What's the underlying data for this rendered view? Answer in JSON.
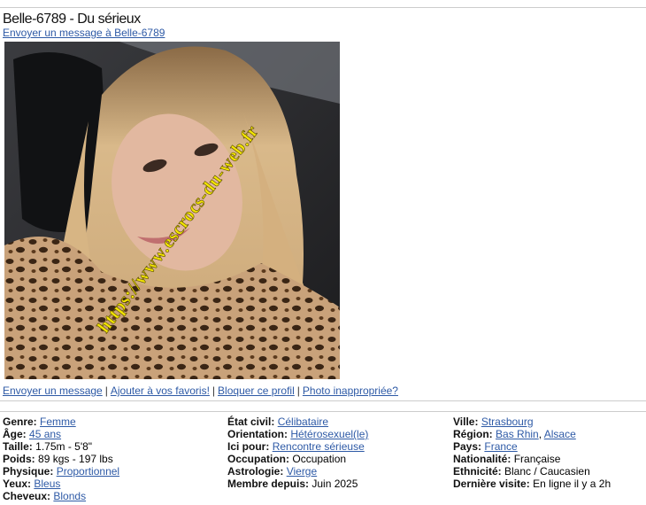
{
  "profile": {
    "title": "Belle-6789 - Du sérieux",
    "message_link": "Envoyer un message à Belle-6789",
    "watermark": "https://www.escrocs-du-web.fr"
  },
  "actions": {
    "send_message": "Envoyer un message",
    "add_favorite": "Ajouter à vos favoris!",
    "block": "Bloquer ce profil",
    "report_photo": "Photo inappropriée?",
    "separator": "|"
  },
  "details": {
    "col1": [
      {
        "label": "Genre:",
        "value": "Femme",
        "link": true
      },
      {
        "label": "Âge:",
        "value": "45 ans",
        "link": true
      },
      {
        "label": "Taille:",
        "value": "1.75m - 5'8\"",
        "link": false
      },
      {
        "label": "Poids:",
        "value": "89 kgs - 197 lbs",
        "link": false
      },
      {
        "label": "Physique:",
        "value": "Proportionnel",
        "link": true
      },
      {
        "label": "Yeux:",
        "value": "Bleus",
        "link": true
      },
      {
        "label": "Cheveux:",
        "value": "Blonds",
        "link": true
      }
    ],
    "col2": [
      {
        "label": "État civil:",
        "value": "Célibataire",
        "link": true
      },
      {
        "label": "Orientation:",
        "value": "Hétérosexuel(le)",
        "link": true
      },
      {
        "label": "Ici pour:",
        "value": "Rencontre sérieuse",
        "link": true
      },
      {
        "label": "Occupation:",
        "value": "Occupation",
        "link": false
      },
      {
        "label": "Astrologie:",
        "value": "Vierge",
        "link": true
      },
      {
        "label": "Membre depuis:",
        "value": "Juin 2025",
        "link": false
      }
    ],
    "col3": [
      {
        "label": "Ville:",
        "value": "Strasbourg",
        "link": true
      },
      {
        "label": "Région:",
        "value": "Bas Rhin",
        "value2": "Alsace",
        "link": true
      },
      {
        "label": "Pays:",
        "value": "France",
        "link": true
      },
      {
        "label": "Nationalité:",
        "value": "Française",
        "link": false
      },
      {
        "label": "Ethnicité:",
        "value": "Blanc / Caucasien",
        "link": false
      },
      {
        "label": "Dernière visite:",
        "value": "En ligne il y a 2h",
        "link": false
      }
    ]
  },
  "colors": {
    "link": "#2e5aa6",
    "rule": "#cccccc",
    "watermark": "#f3e600"
  }
}
